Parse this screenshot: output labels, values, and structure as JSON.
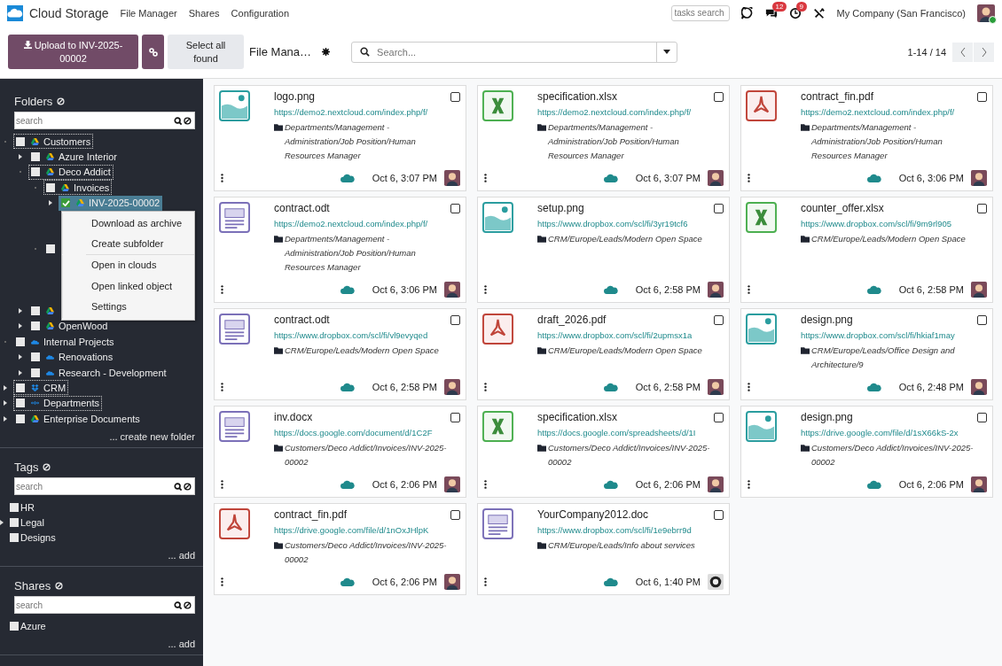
{
  "navbar": {
    "app_name": "Cloud Storage",
    "menu": [
      "File Manager",
      "Shares",
      "Configuration"
    ],
    "tasks_search": {
      "placeholder": "tasks search"
    },
    "messages_badge": "12",
    "activities_badge": "9",
    "company": "My Company (San Francisco)"
  },
  "control_panel": {
    "upload_button": "Upload to INV-2025-00002",
    "select_all_button": "Select all found",
    "view_title": "File Mana…",
    "search": {
      "placeholder": "Search..."
    },
    "pager": "1-14 / 14"
  },
  "sidebar": {
    "folders": {
      "title": "Folders",
      "search": {
        "placeholder": "search"
      },
      "create_link": "... create new folder",
      "tree": [
        {
          "name": "Customers",
          "kind": "drive",
          "boxed": true,
          "selected": false,
          "checked": false,
          "expanded": true,
          "children": [
            {
              "name": "Azure Interior",
              "kind": "drive",
              "boxed": false,
              "selected": false,
              "checked": false,
              "expanded": false
            },
            {
              "name": "Deco Addict",
              "kind": "drive",
              "boxed": true,
              "selected": false,
              "checked": false,
              "expanded": true,
              "children": [
                {
                  "name": "Invoices",
                  "kind": "drive",
                  "boxed": true,
                  "selected": false,
                  "checked": false,
                  "expanded": true,
                  "children": [
                    {
                      "name": "INV-2025-00002",
                      "kind": "drive",
                      "boxed": false,
                      "selected": true,
                      "checked": true,
                      "expanded": false
                    }
                  ]
                },
                {
                  "boxed": false,
                  "selected": false,
                  "checked": false,
                  "expanded": true
                }
              ]
            },
            {
              "kind": "drive",
              "boxed": false,
              "selected": false,
              "checked": false,
              "expanded": false
            },
            {
              "name": "OpenWood",
              "kind": "drive",
              "boxed": false,
              "selected": false,
              "checked": false,
              "expanded": false
            }
          ]
        },
        {
          "name": "Internal Projects",
          "kind": "cloud",
          "boxed": false,
          "selected": false,
          "checked": false,
          "expanded": true,
          "children": [
            {
              "name": "Renovations",
              "kind": "cloud",
              "boxed": false,
              "selected": false,
              "checked": false,
              "expanded": false
            },
            {
              "name": "Research - Development",
              "kind": "cloud",
              "boxed": false,
              "selected": false,
              "checked": false,
              "expanded": false
            }
          ]
        },
        {
          "name": "CRM",
          "kind": "box",
          "boxed": true,
          "selected": false,
          "checked": false,
          "expanded": false
        },
        {
          "name": "Departments",
          "kind": "rings",
          "boxed": true,
          "selected": false,
          "checked": false,
          "expanded": false
        },
        {
          "name": "Enterprise Documents",
          "kind": "drive",
          "boxed": false,
          "selected": false,
          "checked": false,
          "expanded": false
        }
      ]
    },
    "context_menu": [
      [
        "Download as archive",
        "Create subfolder"
      ],
      [
        "Open in clouds",
        "Open linked object",
        "Settings"
      ]
    ],
    "tags": {
      "title": "Tags",
      "search": {
        "placeholder": "search"
      },
      "items": [
        {
          "name": "HR",
          "checked": false,
          "expandable": false
        },
        {
          "name": "Legal",
          "checked": false,
          "expandable": true
        },
        {
          "name": "Designs",
          "checked": false,
          "expandable": false
        }
      ],
      "add_link": "... add"
    },
    "shares": {
      "title": "Shares",
      "search": {
        "placeholder": "search"
      },
      "items": [
        {
          "name": "Azure",
          "checked": false,
          "expandable": false
        }
      ],
      "add_link": "... add"
    }
  },
  "files": [
    {
      "name": "logo.png",
      "kind": "image",
      "url": "https://demo2.nextcloud.com/index.php/f/",
      "path": "Departments/Management - Administration/Job Position/Human Resources Manager",
      "date": "Oct 6, 3:07 PM",
      "checked": false,
      "avatar": {
        "kind": "person"
      }
    },
    {
      "name": "specification.xlsx",
      "kind": "sheet",
      "url": "https://demo2.nextcloud.com/index.php/f/",
      "path": "Departments/Management - Administration/Job Position/Human Resources Manager",
      "date": "Oct 6, 3:07 PM",
      "checked": false,
      "avatar": {
        "kind": "person"
      }
    },
    {
      "name": "contract_fin.pdf",
      "kind": "pdf",
      "url": "https://demo2.nextcloud.com/index.php/f/",
      "path": "Departments/Management - Administration/Job Position/Human Resources Manager",
      "date": "Oct 6, 3:06 PM",
      "checked": false,
      "avatar": {
        "kind": "person"
      }
    },
    {
      "name": "contract.odt",
      "kind": "doc",
      "url": "https://demo2.nextcloud.com/index.php/f/",
      "path": "Departments/Management - Administration/Job Position/Human Resources Manager",
      "date": "Oct 6, 3:06 PM",
      "checked": false,
      "avatar": {
        "kind": "person"
      }
    },
    {
      "name": "setup.png",
      "kind": "image",
      "url": "https://www.dropbox.com/scl/fi/3yr19tcf6",
      "path": "CRM/Europe/Leads/Modern Open Space",
      "date": "Oct 6, 2:58 PM",
      "checked": false,
      "avatar": {
        "kind": "person"
      }
    },
    {
      "name": "counter_offer.xlsx",
      "kind": "sheet",
      "url": "https://www.dropbox.com/scl/fi/9m9rl905",
      "path": "CRM/Europe/Leads/Modern Open Space",
      "date": "Oct 6, 2:58 PM",
      "checked": false,
      "avatar": {
        "kind": "person"
      }
    },
    {
      "name": "contract.odt",
      "kind": "doc",
      "url": "https://www.dropbox.com/scl/fi/vl9evyqed",
      "path": "CRM/Europe/Leads/Modern Open Space",
      "date": "Oct 6, 2:58 PM",
      "checked": false,
      "avatar": {
        "kind": "person"
      }
    },
    {
      "name": "draft_2026.pdf",
      "kind": "pdf",
      "url": "https://www.dropbox.com/scl/fi/2upmsx1a",
      "path": "CRM/Europe/Leads/Modern Open Space",
      "date": "Oct 6, 2:58 PM",
      "checked": false,
      "avatar": {
        "kind": "person"
      }
    },
    {
      "name": "design.png",
      "kind": "image",
      "url": "https://www.dropbox.com/scl/fi/hkiaf1may",
      "path": "CRM/Europe/Leads/Office Design and Architecture/9",
      "date": "Oct 6, 2:48 PM",
      "checked": false,
      "avatar": {
        "kind": "person"
      }
    },
    {
      "name": "inv.docx",
      "kind": "doc",
      "url": "https://docs.google.com/document/d/1C2F",
      "path": "Customers/Deco Addict/Invoices/INV-2025-00002",
      "date": "Oct 6, 2:06 PM",
      "checked": false,
      "avatar": {
        "kind": "person"
      }
    },
    {
      "name": "specification.xlsx",
      "kind": "sheet",
      "url": "https://docs.google.com/spreadsheets/d/1I",
      "path": "Customers/Deco Addict/Invoices/INV-2025-00002",
      "date": "Oct 6, 2:06 PM",
      "checked": false,
      "avatar": {
        "kind": "person"
      }
    },
    {
      "name": "design.png",
      "kind": "image",
      "url": "https://drive.google.com/file/d/1sX66kS-2x",
      "path": "Customers/Deco Addict/Invoices/INV-2025-00002",
      "date": "Oct 6, 2:06 PM",
      "checked": false,
      "avatar": {
        "kind": "person"
      }
    },
    {
      "name": "contract_fin.pdf",
      "kind": "pdf",
      "url": "https://drive.google.com/file/d/1nOxJHlpK",
      "path": "Customers/Deco Addict/Invoices/INV-2025-00002",
      "date": "Oct 6, 2:06 PM",
      "checked": false,
      "avatar": {
        "kind": "person"
      }
    },
    {
      "name": "YourCompany2012.doc",
      "kind": "doc",
      "url": "https://www.dropbox.com/scl/fi/1e9ebrr9d",
      "path": "CRM/Europe/Leads/Info about services",
      "date": "Oct 6, 1:40 PM",
      "checked": false,
      "avatar": {
        "kind": "camera"
      }
    }
  ]
}
